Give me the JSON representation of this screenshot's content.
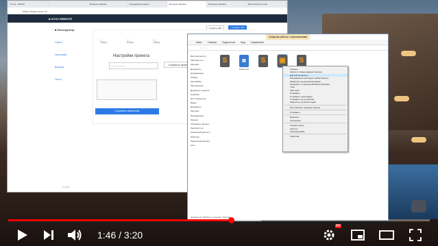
{
  "browser": {
    "tabs": [
      "Почта - Mail.Ru",
      "...",
      "Интернет-магазин",
      "Продающий лендинг",
      "Интернет-магазин",
      "Интернет-магазин",
      "Бесплатный хостинг"
    ],
    "url": "https://www.ucoz.ru/...",
    "appbar_title": "■ UCOZ WEBSITE",
    "section_label": "■ Конструктор",
    "side_items": [
      "Сайты",
      "Настройки",
      "Домены",
      "Почта"
    ],
    "btn_left": "Создать сайт",
    "btn_right": "+ Создать сайт",
    "values": [
      {
        "label": "...",
        "value": "0.00 р."
      },
      {
        "label": "...",
        "value": "0.00 р."
      },
      {
        "label": "...",
        "value": "0.00 р."
      }
    ],
    "panel_title": "Настройки проекта",
    "input_value": "---------------------",
    "save_label": "Сохранить проект",
    "main_button": "Сохранить изменения",
    "footer": "© uCoz   ...   ..."
  },
  "explorer": {
    "title": "Средства работы с приложениями",
    "ribbon": [
      "Файл",
      "Главная",
      "Поделиться",
      "Вид",
      "Управление"
    ],
    "address": "> ... > ...",
    "tree": [
      "Быстрый доступ",
      "Рабочий стол",
      "Загрузки",
      "Документы",
      "Изображения",
      "Облако",
      "Мои файлы",
      "Загруженные",
      "Документы проекта",
      "OneDrive",
      "Этот компьютер",
      "Видео",
      "Документы",
      "Загрузки",
      "Изображения",
      "Музыка",
      "Объемные объекты",
      "Рабочий стол",
      "Локальный диск (C:)",
      "DATA (D:)",
      "Локальный диск (E:)",
      "Сеть"
    ],
    "files": [
      {
        "label": "",
        "icon": "S"
      },
      {
        "label": "Sublime Text",
        "icon": "doc"
      },
      {
        "label": "",
        "icon": "S"
      },
      {
        "label": "",
        "icon": "sel"
      },
      {
        "label": "",
        "icon": "S"
      }
    ],
    "status": "Элементов: 5   Выбран 1 элемент: 8,52 КБ"
  },
  "context_menu": {
    "items": [
      "Открыть",
      "Запуск от имени администратора",
      "Edit with Notepad++",
      "Исправление неполадок совместимости",
      "Закрепить на начальном экране",
      "Проверить с помощью Windows Defender...",
      "7-Zip",
      "CRC SHA",
      "Отправить",
      "Отправить через Skype",
      "Отправить на устройство",
      "Закрепить на панели задач",
      "Восстановить прежнюю версию",
      "Отправить",
      "Вырезать",
      "Копировать",
      "Создать ярлык",
      "Удалить",
      "Переименовать",
      "Свойства"
    ]
  },
  "player": {
    "time_current": "1:46",
    "time_total": "3:20",
    "progress": 0.53,
    "hd_badge": "HD"
  }
}
